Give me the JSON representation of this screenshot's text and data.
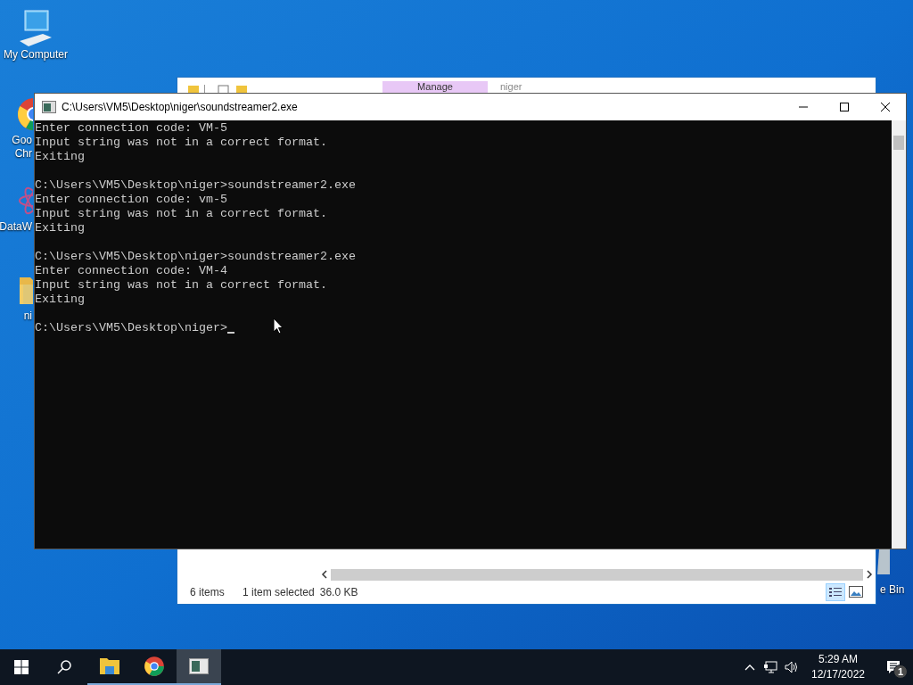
{
  "desktop_icons": [
    {
      "kind": "computer",
      "label": "My Computer"
    },
    {
      "kind": "chrome",
      "label": "Goo\nChr"
    },
    {
      "kind": "dataw",
      "label": "DataW"
    },
    {
      "kind": "folder",
      "label": "ni"
    }
  ],
  "recycle_bin": {
    "label": "e Bin"
  },
  "explorer": {
    "ribbon_tab": "Manage",
    "title": "niger",
    "status": {
      "items": "6 items",
      "selected": "1 item selected",
      "size": "36.0 KB"
    }
  },
  "console": {
    "title": "C:\\Users\\VM5\\Desktop\\niger\\soundstreamer2.exe",
    "blocks": [
      [
        "Enter connection code: VM-5",
        "Input string was not in a correct format.",
        "Exiting"
      ],
      [
        "C:\\Users\\VM5\\Desktop\\niger>soundstreamer2.exe",
        "Enter connection code: vm-5",
        "Input string was not in a correct format.",
        "Exiting"
      ],
      [
        "C:\\Users\\VM5\\Desktop\\niger>soundstreamer2.exe",
        "Enter connection code: VM-4",
        "Input string was not in a correct format.",
        "Exiting"
      ],
      [
        "C:\\Users\\VM5\\Desktop\\niger>"
      ]
    ]
  },
  "taskbar": {
    "apps": [
      {
        "kind": "explorer",
        "selected": false
      },
      {
        "kind": "chrome",
        "selected": false
      },
      {
        "kind": "console",
        "selected": true
      }
    ],
    "time": "5:29 AM",
    "date": "12/17/2022",
    "notifications": "1"
  }
}
